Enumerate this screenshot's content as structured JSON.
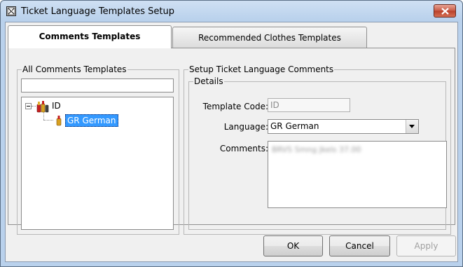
{
  "window": {
    "title": "Ticket Language Templates Setup",
    "icon": "app-window-icon",
    "close_icon": "close-icon"
  },
  "tabs": [
    {
      "label": "Comments Templates",
      "selected": true
    },
    {
      "label": "Recommended Clothes Templates",
      "selected": false
    }
  ],
  "left_panel": {
    "group_label": "All Comments Templates",
    "search_value": "",
    "tree": {
      "root": {
        "label": "ID",
        "icon": "bottles-icon",
        "expanded": true
      },
      "children": [
        {
          "label": "GR German",
          "icon": "bottle-icon",
          "selected": true
        }
      ]
    }
  },
  "right_panel": {
    "group_label": "Setup Ticket Language Comments",
    "details_label": "Details",
    "template_code": {
      "label": "Template Code:",
      "value": "ID"
    },
    "language": {
      "label": "Language:",
      "value": "GR German"
    },
    "comments": {
      "label": "Comments:",
      "value": "BRVS Smng Jkels 37.00"
    }
  },
  "buttons": {
    "ok": "OK",
    "cancel": "Cancel",
    "apply": "Apply"
  },
  "colors": {
    "selection": "#3399ff",
    "window_frame": "#b9d1ec",
    "close_button": "#c75a45"
  }
}
